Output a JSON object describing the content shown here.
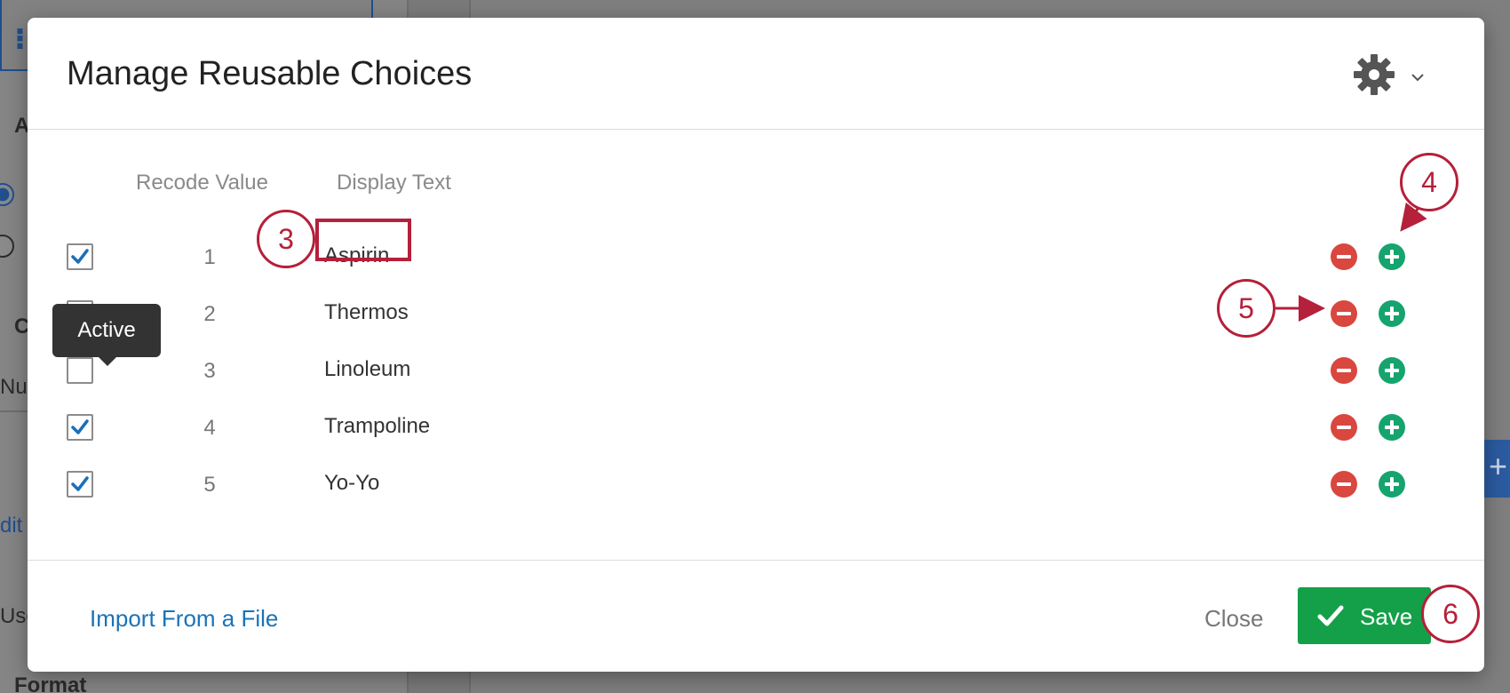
{
  "background": {
    "labels": {
      "a": "A",
      "c": "C",
      "num": "Num",
      "edit": "dit",
      "use": "Use",
      "format": "Format"
    }
  },
  "modal": {
    "title": "Manage Reusable Choices",
    "settings_icon": "gear-icon",
    "columns": {
      "recode": "Recode Value",
      "display": "Display Text"
    },
    "rows": [
      {
        "recode": "1",
        "display": "Aspirin",
        "active": true
      },
      {
        "recode": "2",
        "display": "Thermos",
        "active": true
      },
      {
        "recode": "3",
        "display": "Linoleum",
        "active": false
      },
      {
        "recode": "4",
        "display": "Trampoline",
        "active": true
      },
      {
        "recode": "5",
        "display": "Yo-Yo",
        "active": true
      }
    ],
    "tooltip": "Active",
    "footer": {
      "import_label": "Import From a File",
      "close_label": "Close",
      "save_label": "Save"
    }
  },
  "annotations": {
    "step3": "3",
    "step4": "4",
    "step5": "5",
    "step6": "6"
  },
  "colors": {
    "accent_save": "#14a049",
    "remove": "#d9473f",
    "add": "#15a46e",
    "link": "#1a73b8",
    "annotation": "#b5203a"
  }
}
